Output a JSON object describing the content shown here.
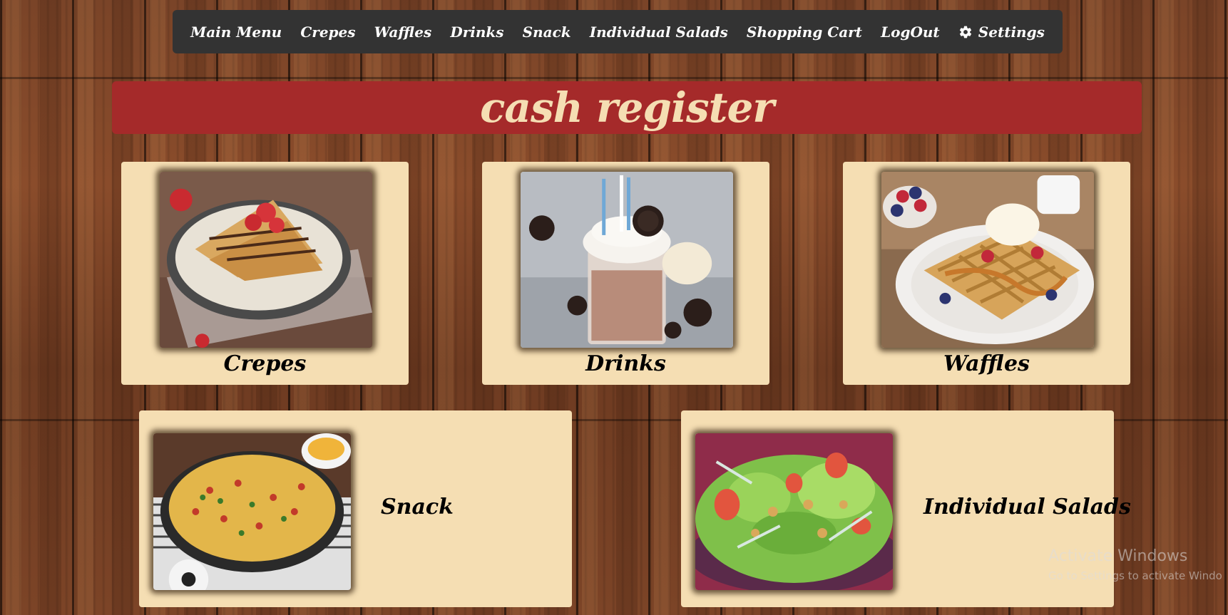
{
  "nav": {
    "items": [
      {
        "label": "Main Menu"
      },
      {
        "label": "Crepes"
      },
      {
        "label": "Waffles"
      },
      {
        "label": "Drinks"
      },
      {
        "label": "Snack"
      },
      {
        "label": "Individual Salads"
      },
      {
        "label": "Shopping Cart"
      },
      {
        "label": "LogOut"
      },
      {
        "label": "Settings",
        "icon": "gear-icon"
      }
    ]
  },
  "header": {
    "title": "cash register"
  },
  "categories": [
    {
      "label": "Crepes",
      "image": "crepes-photo"
    },
    {
      "label": "Drinks",
      "image": "drinks-photo"
    },
    {
      "label": "Waffles",
      "image": "waffles-photo"
    },
    {
      "label": "Snack",
      "image": "snack-photo"
    },
    {
      "label": "Individual Salads",
      "image": "salad-photo"
    }
  ],
  "watermark": {
    "line1": "Activate Windows",
    "line2": "Go to Settings to activate Windo"
  },
  "colors": {
    "navbar": "#333333",
    "title_bar": "#a52a2a",
    "title_text": "#f5deb3",
    "card": "#f5deb3"
  }
}
